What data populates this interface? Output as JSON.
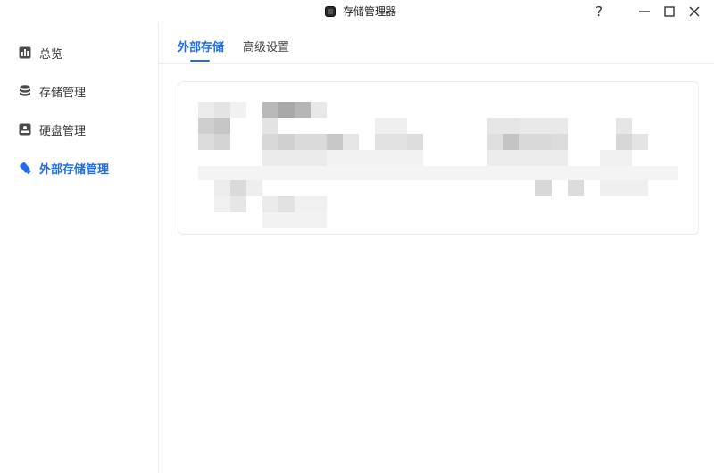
{
  "window": {
    "title": "存储管理器",
    "help_glyph": "?",
    "minimize_glyph": "—",
    "maximize_glyph": "□",
    "close_glyph": "✕"
  },
  "sidebar": {
    "items": [
      {
        "label": "总览",
        "icon": "chart-icon",
        "active": false
      },
      {
        "label": "存储管理",
        "icon": "database-icon",
        "active": false
      },
      {
        "label": "硬盘管理",
        "icon": "disk-icon",
        "active": false
      },
      {
        "label": "外部存储管理",
        "icon": "usb-drive-icon",
        "active": true
      }
    ]
  },
  "main": {
    "tabs": [
      {
        "label": "外部存储",
        "active": true
      },
      {
        "label": "高级设置",
        "active": false
      }
    ]
  },
  "colors": {
    "accent": "#1f6fe8",
    "sidebar_text": "#3a3a3a",
    "border": "#ececec"
  }
}
